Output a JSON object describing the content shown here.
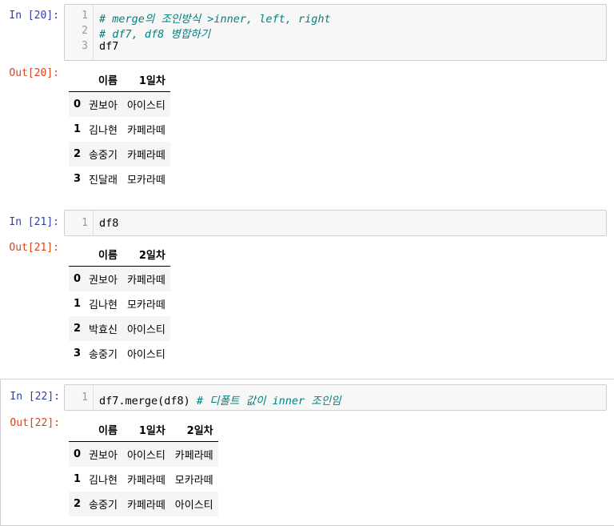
{
  "cells": [
    {
      "in_prompt": "In [20]:",
      "line_numbers": [
        "1",
        "2",
        "3"
      ],
      "lines": [
        {
          "comment": "# merge의 조인방식 >inner, left, right"
        },
        {
          "comment": "# df7, df8 병합하기"
        },
        {
          "code": "df7"
        }
      ],
      "out_prompt": "Out[20]:",
      "table": {
        "columns": [
          "",
          "이름",
          "1일차"
        ],
        "rows": [
          [
            "0",
            "권보아",
            "아이스티"
          ],
          [
            "1",
            "김나현",
            "카페라떼"
          ],
          [
            "2",
            "송중기",
            "카페라떼"
          ],
          [
            "3",
            "진달래",
            "모카라떼"
          ]
        ]
      }
    },
    {
      "in_prompt": "In [21]:",
      "line_numbers": [
        "1"
      ],
      "lines": [
        {
          "code": "df8"
        }
      ],
      "out_prompt": "Out[21]:",
      "table": {
        "columns": [
          "",
          "이름",
          "2일차"
        ],
        "rows": [
          [
            "0",
            "권보아",
            "카페라떼"
          ],
          [
            "1",
            "김나현",
            "모카라떼"
          ],
          [
            "2",
            "박효신",
            "아이스티"
          ],
          [
            "3",
            "송중기",
            "아이스티"
          ]
        ]
      }
    },
    {
      "in_prompt": "In [22]:",
      "line_numbers": [
        "1"
      ],
      "lines": [
        {
          "code": "df7.merge(df8) ",
          "comment": "# 디폴트 값이 inner 조인임"
        }
      ],
      "out_prompt": "Out[22]:",
      "table": {
        "columns": [
          "",
          "이름",
          "1일차",
          "2일차"
        ],
        "rows": [
          [
            "0",
            "권보아",
            "아이스티",
            "카페라떼"
          ],
          [
            "1",
            "김나현",
            "카페라떼",
            "모카라떼"
          ],
          [
            "2",
            "송중기",
            "카페라떼",
            "아이스티"
          ]
        ]
      }
    }
  ]
}
